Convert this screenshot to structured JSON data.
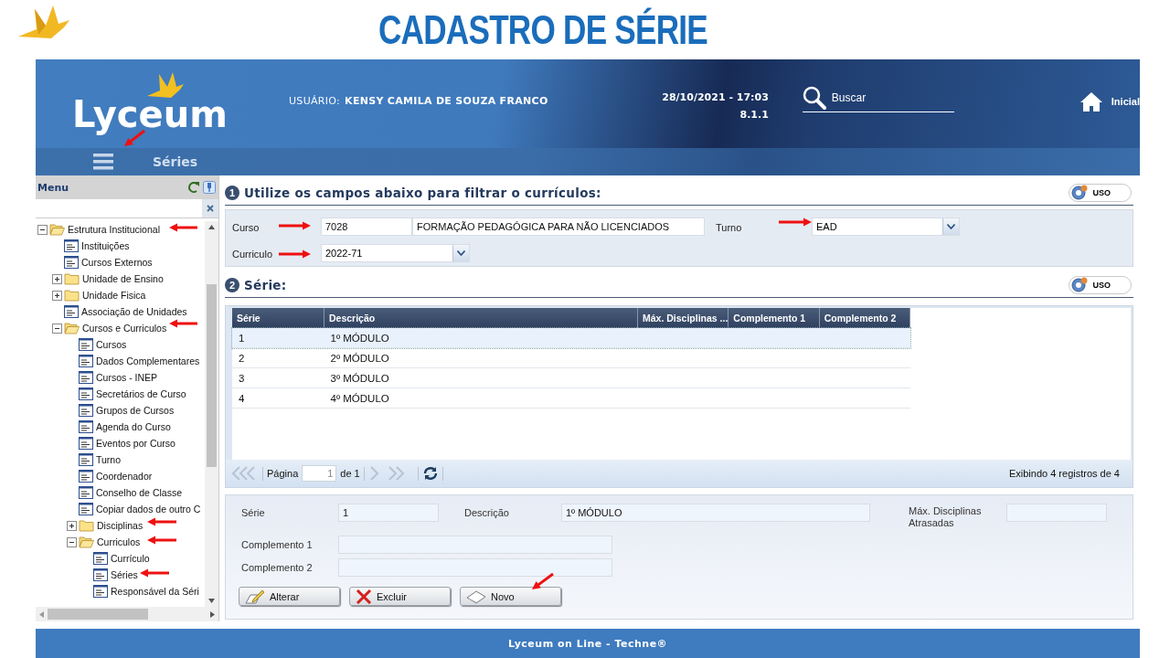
{
  "slide": {
    "title": "CADASTRO DE SÉRIE"
  },
  "header": {
    "logo": "Lyceum",
    "user_label": "USUÁRIO:",
    "user_name": "KENSY CAMILA DE SOUZA FRANCO",
    "datetime": "28/10/2021 - 17:03",
    "version": "8.1.1",
    "search": {
      "placeholder": "Buscar"
    },
    "home_link": "Inicial"
  },
  "nav": {
    "page_title": "Séries"
  },
  "sidebar": {
    "title": "Menu",
    "tree": [
      {
        "label": "Estrutura Institucional",
        "kind": "folder",
        "expanded": true,
        "children": [
          {
            "label": "Instituições",
            "kind": "page"
          },
          {
            "label": "Cursos Externos",
            "kind": "page"
          },
          {
            "label": "Unidade de Ensino",
            "kind": "folder",
            "expanded": false
          },
          {
            "label": "Unidade Fisica",
            "kind": "folder",
            "expanded": false
          },
          {
            "label": "Associação de Unidades",
            "kind": "page"
          },
          {
            "label": "Cursos e Curriculos",
            "kind": "folder",
            "expanded": true,
            "children": [
              {
                "label": "Cursos",
                "kind": "page"
              },
              {
                "label": "Dados Complementares",
                "kind": "page"
              },
              {
                "label": "Cursos - INEP",
                "kind": "page"
              },
              {
                "label": "Secretários de Curso",
                "kind": "page"
              },
              {
                "label": "Grupos de Cursos",
                "kind": "page"
              },
              {
                "label": "Agenda do Curso",
                "kind": "page"
              },
              {
                "label": "Eventos por Curso",
                "kind": "page"
              },
              {
                "label": "Turno",
                "kind": "page"
              },
              {
                "label": "Coordenador",
                "kind": "page"
              },
              {
                "label": "Conselho de Classe",
                "kind": "page"
              },
              {
                "label": "Copiar dados de outro C",
                "kind": "page"
              },
              {
                "label": "Disciplinas",
                "kind": "folder",
                "expanded": false
              },
              {
                "label": "Curriculos",
                "kind": "folder",
                "expanded": true,
                "children": [
                  {
                    "label": "Currículo",
                    "kind": "page"
                  },
                  {
                    "label": "Séries",
                    "kind": "page"
                  },
                  {
                    "label": "Responsável da Séri",
                    "kind": "page"
                  }
                ]
              }
            ]
          }
        ]
      }
    ]
  },
  "filter_section": {
    "number": "1",
    "title": "Utilize os campos abaixo para filtrar o currículos:",
    "toggle_label": "USO",
    "curso_label": "Curso",
    "curso_code": "7028",
    "curso_name": "FORMAÇÃO PEDAGÓGICA PARA NÃO LICENCIADOS",
    "turno_label": "Turno",
    "turno_value": "EAD",
    "curriculo_label": "Curriculo",
    "curriculo_value": "2022-71"
  },
  "serie_section": {
    "number": "2",
    "title": "Série:",
    "toggle_label": "USO"
  },
  "table": {
    "columns": [
      "Série",
      "Descrição",
      "Máx. Disciplinas ...",
      "Complemento 1",
      "Complemento 2"
    ],
    "rows": [
      {
        "serie": "1",
        "descricao": "1º MÓDULO",
        "selected": true
      },
      {
        "serie": "2",
        "descricao": "2º MÓDULO",
        "selected": false
      },
      {
        "serie": "3",
        "descricao": "3º MÓDULO",
        "selected": false
      },
      {
        "serie": "4",
        "descricao": "4º MÓDULO",
        "selected": false
      }
    ]
  },
  "pager": {
    "page_label": "Página",
    "page": "1",
    "of_label": "de 1",
    "records": "Exibindo 4 registros de 4"
  },
  "detail": {
    "serie_label": "Série",
    "serie_value": "1",
    "descricao_label": "Descrição",
    "descricao_value": "1º MÓDULO",
    "max_label": "Máx. Disciplinas Atrasadas",
    "complemento1_label": "Complemento 1",
    "complemento2_label": "Complemento 2",
    "buttons": [
      {
        "label": "Alterar",
        "kind": "edit"
      },
      {
        "label": "Excluir",
        "kind": "delete"
      },
      {
        "label": "Novo",
        "kind": "new"
      }
    ]
  },
  "footer": {
    "text": "Lyceum on Line - Techne®"
  }
}
